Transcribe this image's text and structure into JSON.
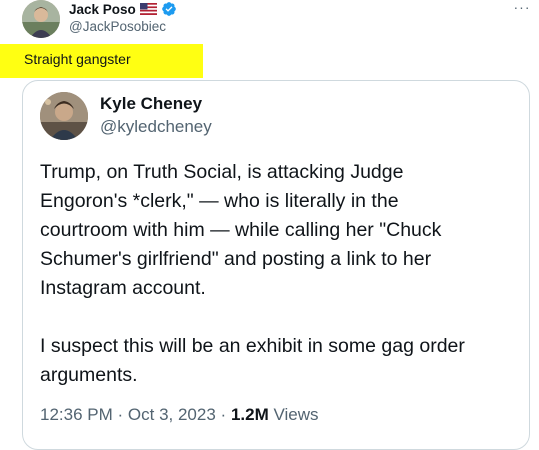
{
  "tweet": {
    "author": {
      "name": "Jack Poso",
      "handle": "@JackPosobiec",
      "flag_icon": "us-flag-icon",
      "verified_icon": "verified-badge-icon",
      "verified_color": "#1d9bf0"
    },
    "more_icon": "more-options-icon",
    "more_label": "···",
    "text": "Straight gangster",
    "highlight_color": "#ffff12"
  },
  "quoted": {
    "author": {
      "name": "Kyle Cheney",
      "handle": "@kyledcheney"
    },
    "body_lines": [
      "Trump, on Truth Social, is attacking Judge",
      "Engoron's *clerk,\" — who is literally in the",
      "courtroom with him — while calling her \"Chuck",
      "Schumer's girlfriend\" and posting a link to her",
      "Instagram account.",
      "I suspect this will be an exhibit in some gag order",
      "arguments."
    ],
    "time": "12:36 PM",
    "separator": "·",
    "date": "Oct 3, 2023",
    "views_count": "1.2M",
    "views_label": "Views"
  }
}
